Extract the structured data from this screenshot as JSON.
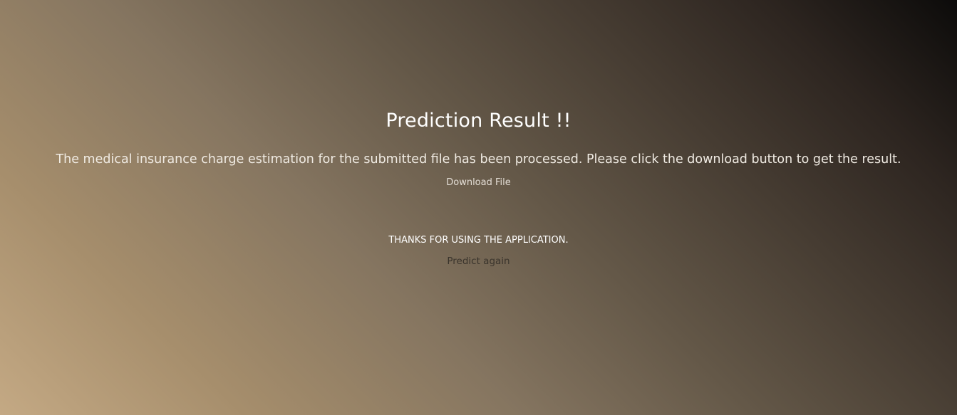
{
  "result": {
    "title": "Prediction Result !!",
    "message": "The medical insurance charge estimation for the submitted file has been processed. Please click the download button to get the result.",
    "download_label": "Download File",
    "thanks_text": "THANKS FOR USING THE APPLICATION.",
    "predict_again_label": "Predict again"
  },
  "colors": {
    "gradient_light": "#c4a984",
    "gradient_dark": "#0c0b0a",
    "predict_link": "#3a342c"
  }
}
